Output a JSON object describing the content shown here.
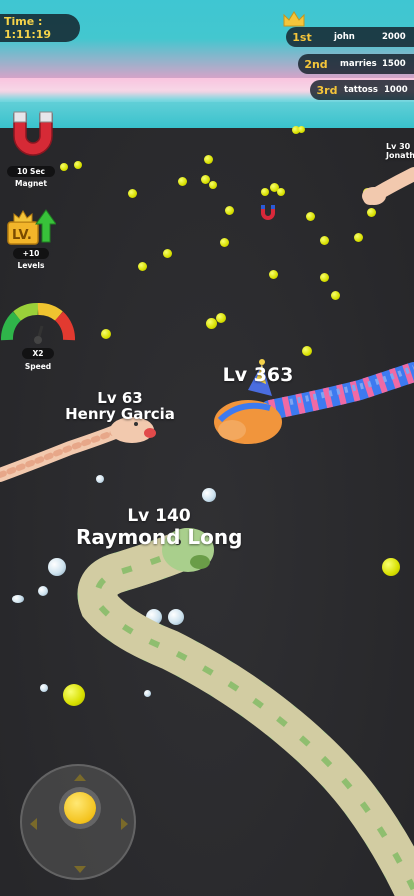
{
  "hud": {
    "timer_label": "Time : 1:11:19"
  },
  "leaderboard": [
    {
      "rank": "1st",
      "name": "john",
      "score": "2000"
    },
    {
      "rank": "2nd",
      "name": "marries",
      "score": "1500"
    },
    {
      "rank": "3rd",
      "name": "tattoss",
      "score": "1000"
    }
  ],
  "powerups": {
    "magnet": {
      "value": "10 Sec",
      "label": "Magnet",
      "icon": "magnet-icon"
    },
    "levels": {
      "value": "+10",
      "label": "Levels",
      "icon": "level-up-icon"
    },
    "speed": {
      "value": "X2",
      "label": "Speed",
      "icon": "speedometer-icon"
    }
  },
  "snakes": [
    {
      "level": "Lv 63",
      "name": "Henry Garcia"
    },
    {
      "level": "Lv 363",
      "name": ""
    },
    {
      "level": "Lv 140",
      "name": "Raymond Long"
    },
    {
      "level": "Lv 30",
      "name": "Jonathan"
    }
  ],
  "colors": {
    "accent_gold": "#f4c53a",
    "pellet": "#e6f000",
    "arena": "#2b2b2e",
    "border": "#3fc6d2"
  }
}
